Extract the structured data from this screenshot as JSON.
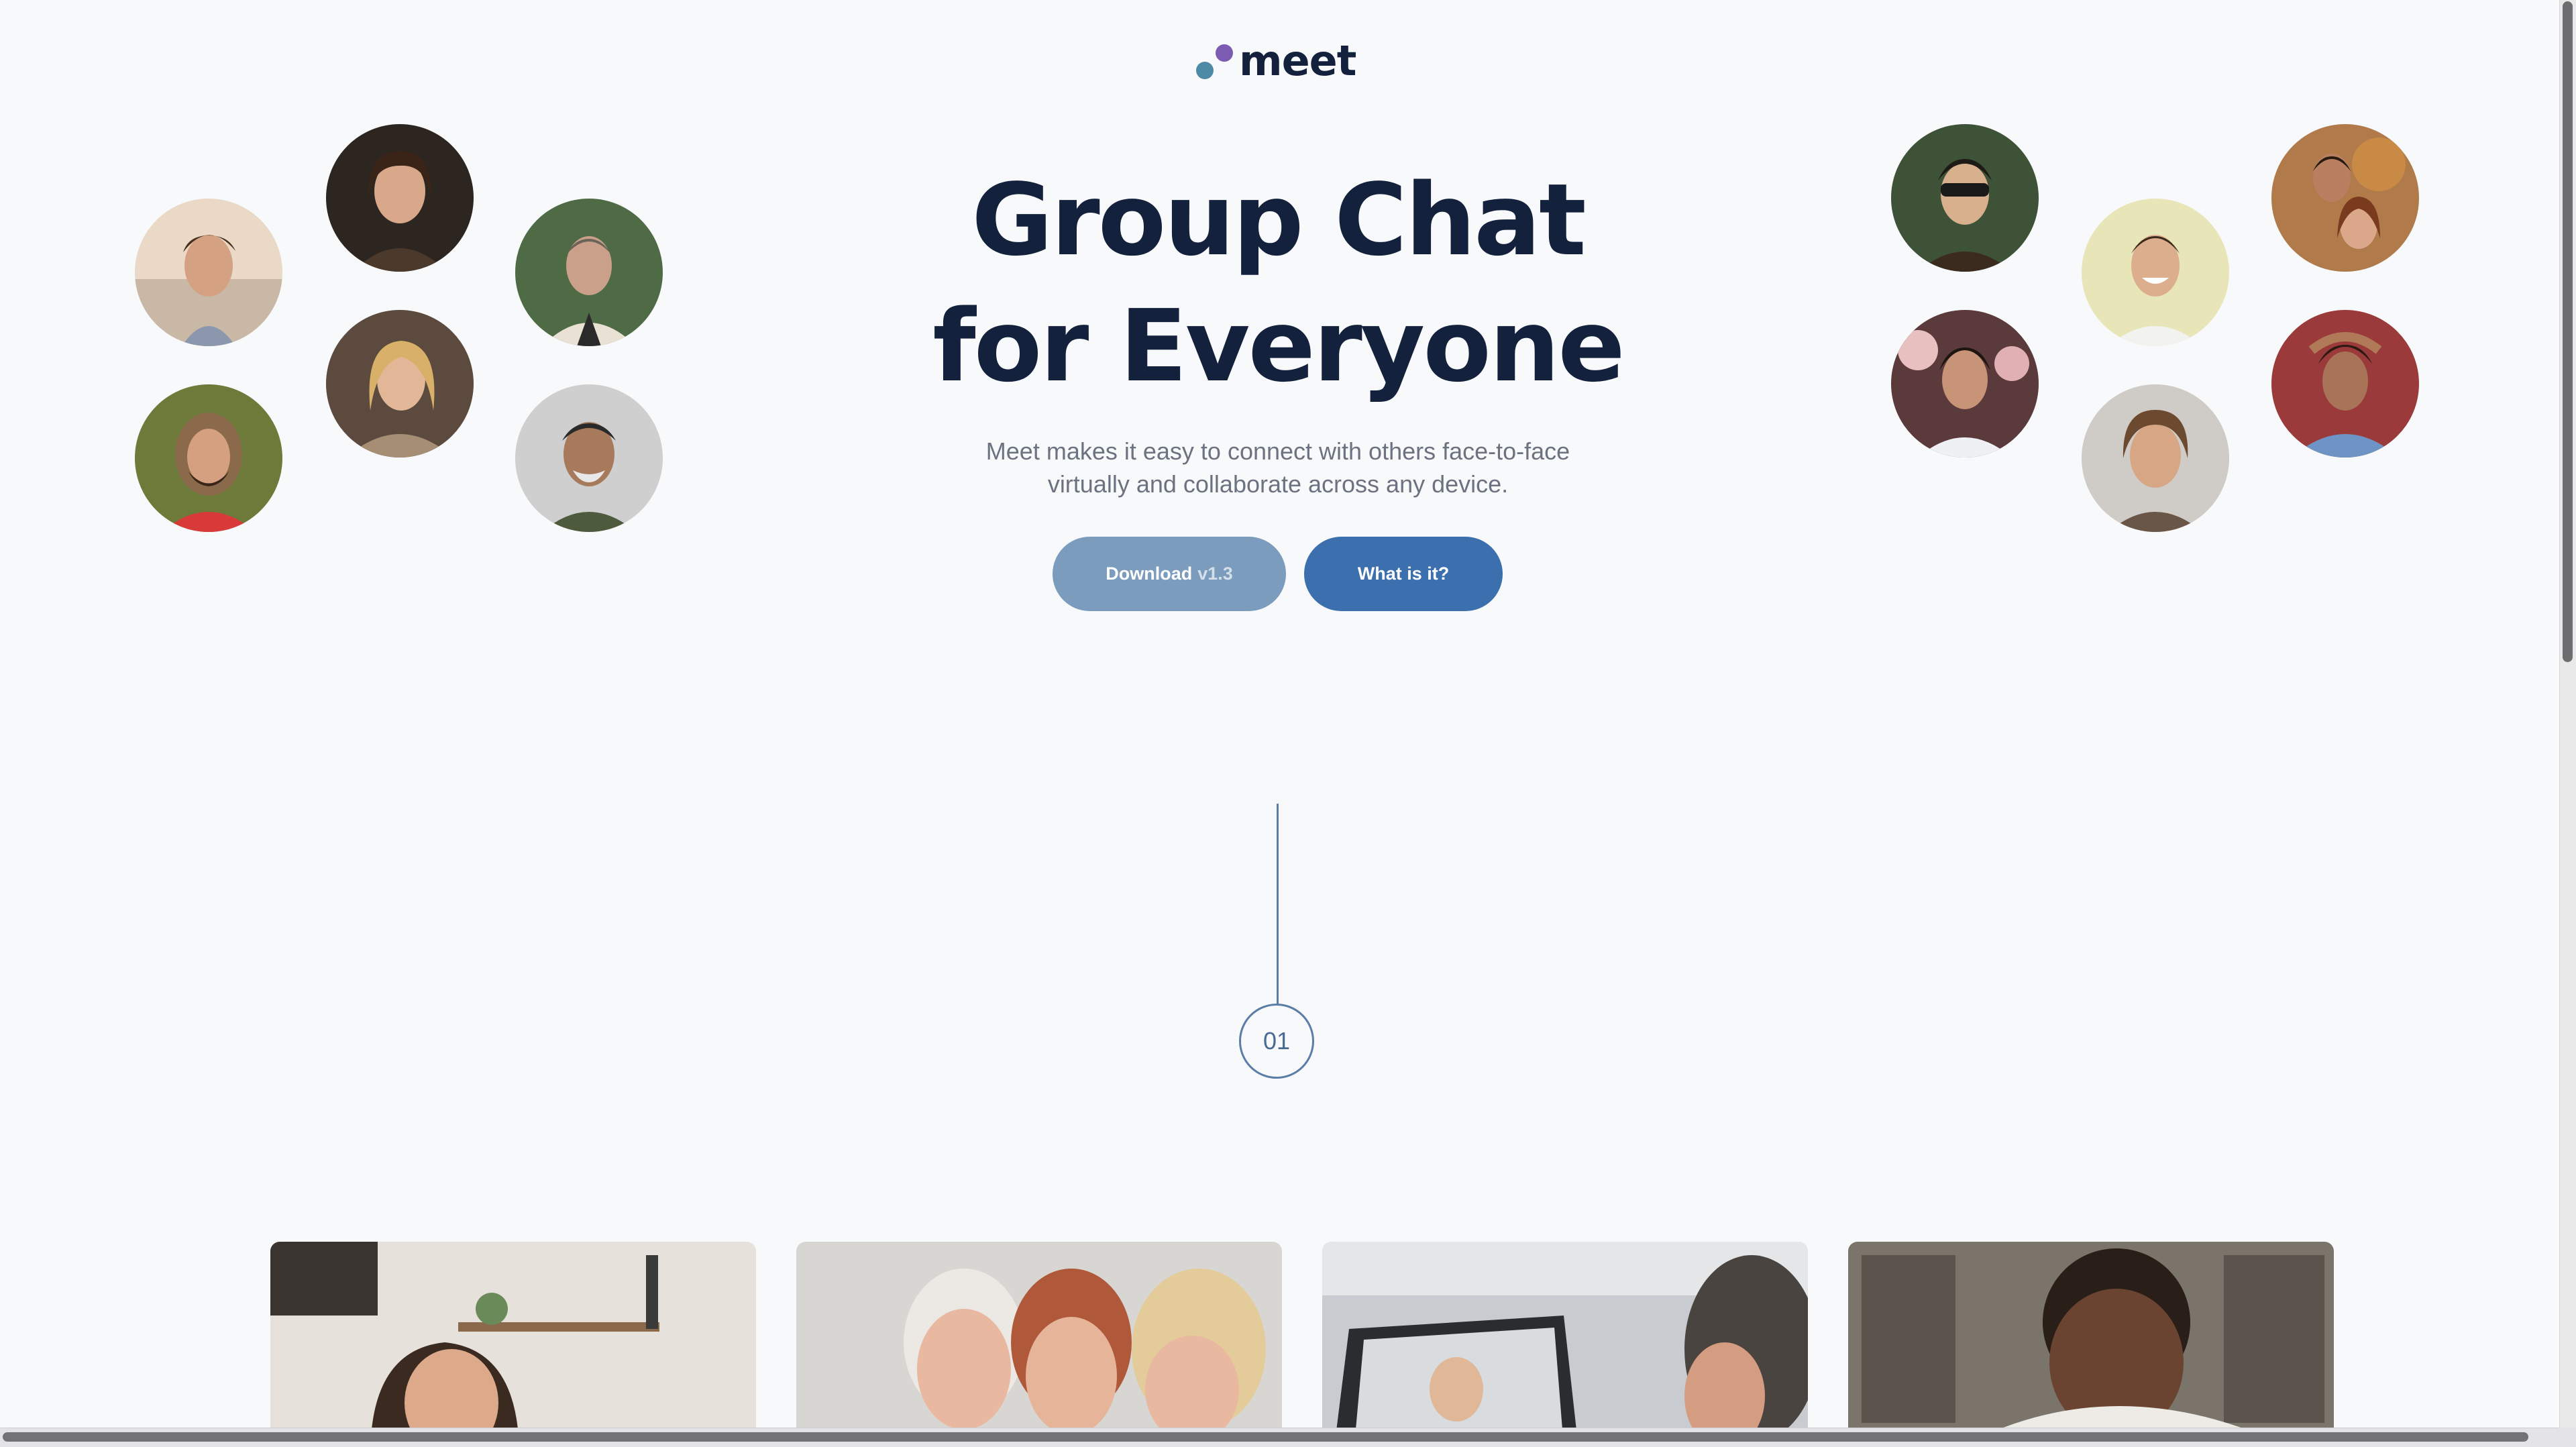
{
  "brand": {
    "logo_text": "meet",
    "dot_colors": [
      "#4c8aa6",
      "#7c5bb3"
    ]
  },
  "hero": {
    "title_line1": "Group Chat",
    "title_line2": "for Everyone",
    "subtitle_line1": "Meet makes it easy to connect with others face-to-face",
    "subtitle_line2": "virtually and collaborate across any device."
  },
  "buttons": {
    "download_label": "Download",
    "download_version": "v1.3",
    "what_label": "What is it?"
  },
  "timeline": {
    "step": "01"
  },
  "colors": {
    "navy": "#13213d",
    "download_button": "#7b9cbc",
    "primary_button": "#3b6fad",
    "background": "#f8f9fb"
  }
}
